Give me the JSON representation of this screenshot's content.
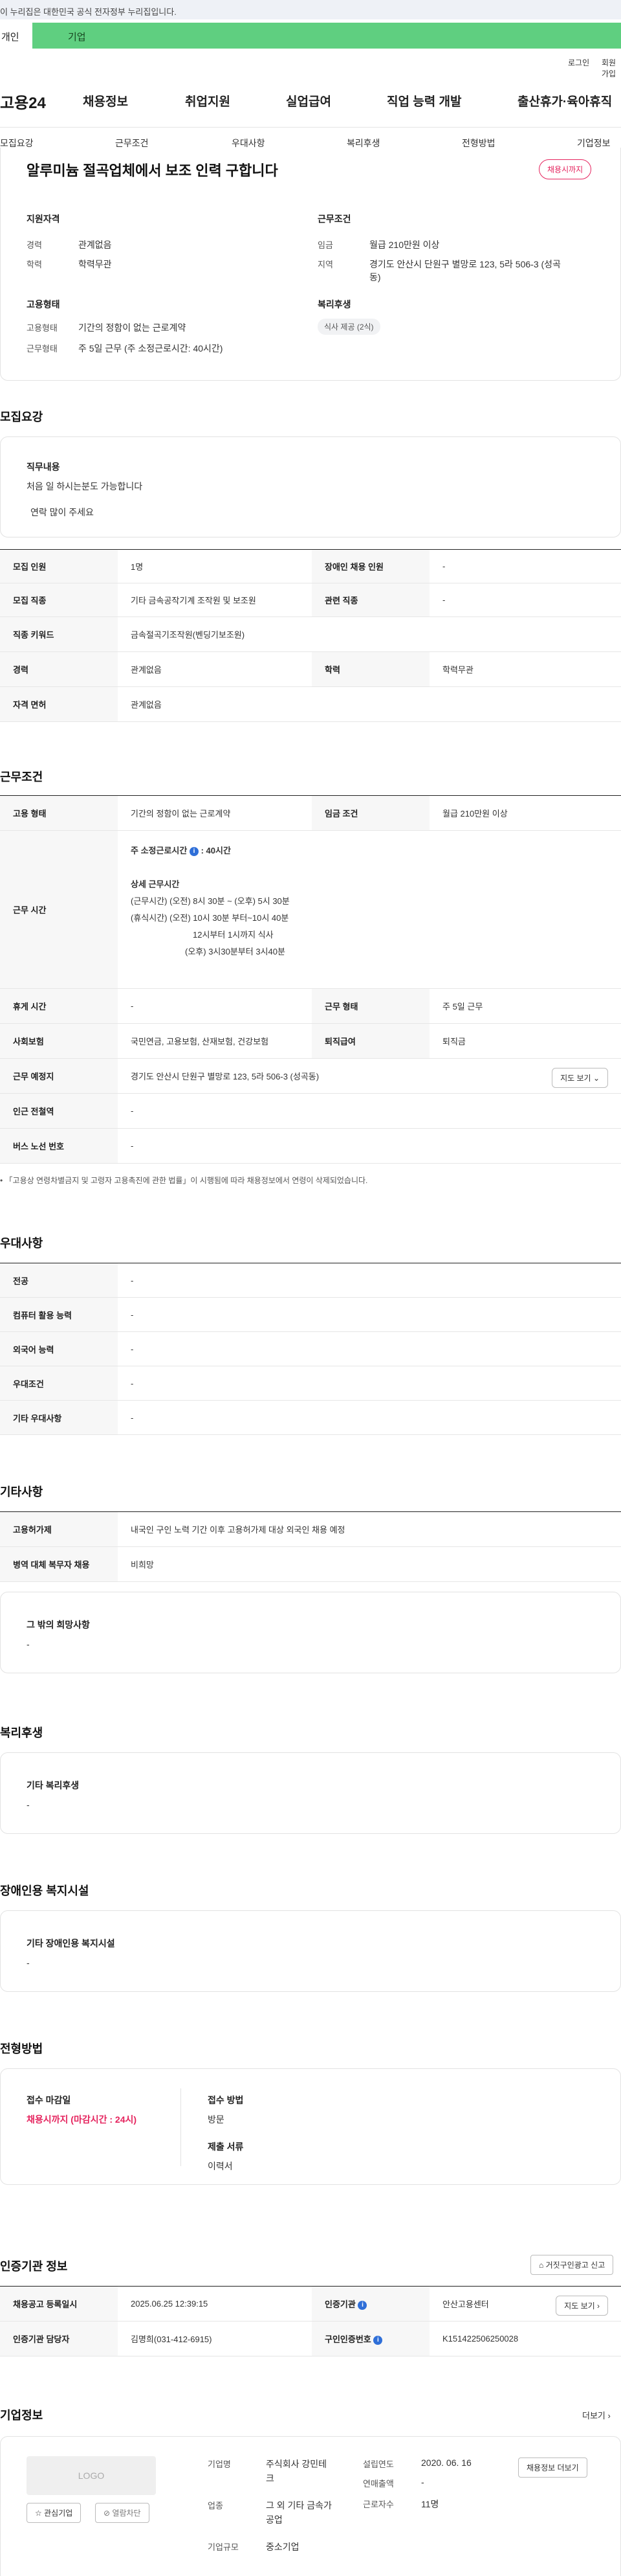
{
  "gov_banner": "이 누리집은 대한민국 공식 전자정부 누리집입니다.",
  "user_tabs": {
    "personal": "개인",
    "company": "기업"
  },
  "util": {
    "login": "로그인",
    "join": "회원가입"
  },
  "logo": "고용24",
  "gnb": [
    "채용정보",
    "취업지원",
    "실업급여",
    "직업 능력 개발",
    "출산휴가·육아휴직"
  ],
  "snb": [
    "모집요강",
    "근무조건",
    "우대사항",
    "복리후생",
    "전형방법",
    "기업정보"
  ],
  "job_title": "알루미늄 절곡업체에서 보조 인력 구합니다",
  "deadline_badge": "채용시까지",
  "summary": {
    "qual_title": "지원자격",
    "career_label": "경력",
    "career_value": "관계없음",
    "edu_label": "학력",
    "edu_value": "학력무관",
    "cond_title": "근무조건",
    "wage_label": "임금",
    "wage_value": "월급 210만원 이상",
    "region_label": "지역",
    "region_value_1": "경기도 안산시 단원구 별망로 123, 5라 506-3 (성곡",
    "region_value_2": "동)",
    "emp_title": "고용형태",
    "emp_label": "고용형태",
    "emp_value": "기간의 정함이 없는 근로계약",
    "hours_label": "근무형태",
    "hours_value": "주 5일 근무 (주 소정근로시간: 40시간)",
    "welfare_title": "복리후생",
    "welfare_chip": "식사 제공 (2식)"
  },
  "recruit": {
    "heading": "모집요강",
    "duty_title": "직무내용",
    "duty_line1": "처음 일 하시는분도 가능합니다",
    "duty_line2": "연락 많이 주세요",
    "rows": {
      "headcount_l": "모집 인원",
      "headcount_v": "1명",
      "disabled_l": "장애인 채용 인원",
      "disabled_v": "-",
      "job_l": "모집 직종",
      "job_v": "기타 금속공작기계 조작원 및 보조원",
      "related_l": "관련 직종",
      "related_v": "-",
      "keyword_l": "직종 키워드",
      "keyword_v": "금속절곡기조작원(벤딩기보조원)",
      "career_l": "경력",
      "career_v": "관계없음",
      "edu_l": "학력",
      "edu_v": "학력무관",
      "license_l": "자격 면허",
      "license_v": "관계없음"
    }
  },
  "work": {
    "heading": "근무조건",
    "emp_l": "고용 형태",
    "emp_v": "기간의 정함이 없는 근로계약",
    "wage_l": "임금 조건",
    "wage_v": "월급 210만원 이상",
    "time_l": "근무 시간",
    "time_weekly": "주 소정근로시간",
    "time_weekly_v": ": 40시간",
    "time_detail_title": "상세 근무시간",
    "time_lines": [
      "(근무시간) (오전) 8시 30분 ~ (오후) 5시 30분",
      "(휴식시간) (오전) 10시 30분 부터~10시 40분",
      "12시부터 1시까지 식사",
      "(오후) 3시30분부터 3시40분"
    ],
    "rest_l": "휴게 시간",
    "rest_v": "-",
    "type_l": "근무 형태",
    "type_v": "주 5일 근무",
    "ins_l": "사회보험",
    "ins_v": "국민연금, 고용보험, 산재보험, 건강보험",
    "sev_l": "퇴직급여",
    "sev_v": "퇴직금",
    "place_l": "근무 예정지",
    "place_v": "경기도 안산시 단원구 별망로 123, 5라 506-3 (성곡동)",
    "map_btn": "지도 보기",
    "subway_l": "인근 전철역",
    "subway_v": "-",
    "bus_l": "버스 노선 번호",
    "bus_v": "-",
    "note": "「고용상 연령차별금지 및 고령자 고용촉진에 관한 법률」이 시행됨에 따라 채용정보에서 연령이 삭제되었습니다."
  },
  "pref": {
    "heading": "우대사항",
    "major_l": "전공",
    "major_v": "-",
    "pc_l": "컴퓨터 활용 능력",
    "pc_v": "-",
    "lang_l": "외국어 능력",
    "lang_v": "-",
    "cond_l": "우대조건",
    "cond_v": "-",
    "etc_l": "기타 우대사항",
    "etc_v": "-"
  },
  "etc": {
    "heading": "기타사항",
    "foreign_l": "고용허가제",
    "foreign_v": "내국인 구인 노력 기간 이후 고용허가제 대상 외국인 채용 예정",
    "military_l": "병역 대체 복무자 채용",
    "military_v": "비희망",
    "wish_title": "그 밖의 희망사항",
    "wish_v": "-"
  },
  "welfare": {
    "heading": "복리후생",
    "title": "기타 복리후생",
    "value": "-"
  },
  "disabled": {
    "heading": "장애인용 복지시설",
    "title": "기타 장애인용 복지시설",
    "value": "-"
  },
  "process": {
    "heading": "전형방법",
    "deadline_title": "접수 마감일",
    "deadline_value": "채용시까지 (마감시간 : 24시)",
    "method_title": "접수 방법",
    "method_value": "방문",
    "docs_title": "제출 서류",
    "docs_value": "이력서"
  },
  "agency": {
    "heading": "인증기관 정보",
    "report_btn": "거짓구인광고 신고",
    "date_l": "채용공고 등록일시",
    "date_v": "2025.06.25 12:39:15",
    "org_l": "인증기관",
    "org_v": "안산고용센터",
    "map_btn": "지도 보기",
    "staff_l": "인증기관 담당자",
    "staff_v": "김명희(031-412-6915)",
    "cert_l": "구인인증번호",
    "cert_v": "K151422506250028"
  },
  "company": {
    "heading": "기업정보",
    "more": "더보기",
    "logo_text": "LOGO",
    "fav_btn": "관심기업",
    "block_btn": "열람차단",
    "name_l": "기업명",
    "name_v1": "주식회사 강민테",
    "name_v2": "크",
    "industry_l": "업종",
    "industry_v1": "그 외 기타 금속가",
    "industry_v2": "공업",
    "size_l": "기업규모",
    "size_v": "중소기업",
    "year_l": "설립연도",
    "year_v": "2020. 06. 16",
    "sales_l": "연매출액",
    "sales_v": "-",
    "emp_l": "근로자수",
    "emp_v": "11명",
    "job_btn": "채용정보 더보기"
  }
}
